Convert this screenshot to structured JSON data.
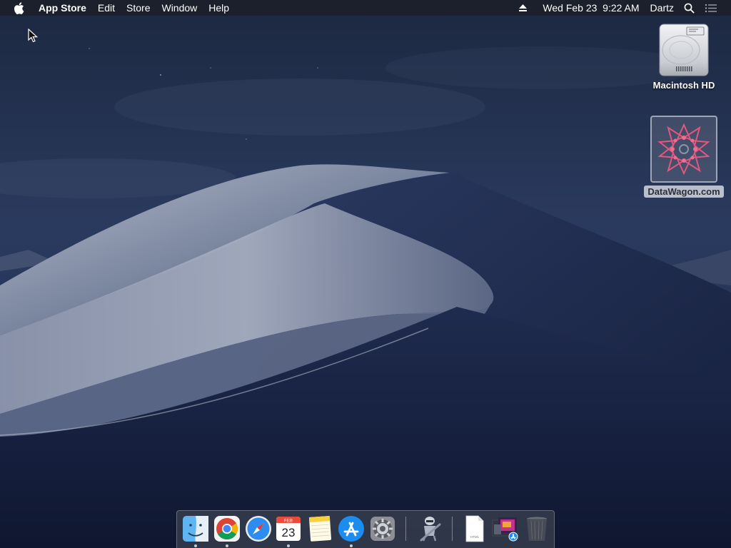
{
  "menubar": {
    "app_name": "App Store",
    "menus": [
      "Edit",
      "Store",
      "Window",
      "Help"
    ],
    "datetime": "Wed Feb 23  9:22 AM",
    "user": "Dartz"
  },
  "desktop_icons": {
    "hd": {
      "label": "Macintosh HD"
    },
    "datawagon": {
      "label": "DataWagon.com"
    }
  },
  "dock": {
    "items": [
      {
        "name": "finder",
        "running": true
      },
      {
        "name": "chrome",
        "running": true
      },
      {
        "name": "safari",
        "running": false
      },
      {
        "name": "calendar",
        "running": true,
        "month": "FEB",
        "day": "23"
      },
      {
        "name": "notes",
        "running": false
      },
      {
        "name": "app-store",
        "running": true
      },
      {
        "name": "system-preferences",
        "running": false
      },
      {
        "name": "automator",
        "running": false
      },
      {
        "name": "html-document",
        "running": false,
        "label": "HTML"
      },
      {
        "name": "downloads-stack",
        "running": false
      },
      {
        "name": "trash",
        "running": false
      }
    ]
  },
  "colors": {
    "menubar": "#1c202a",
    "sky_top": "#1f2c45",
    "dune_light": "#9aa3b8",
    "dune_shadow": "#1c2748",
    "accent_blue": "#1b8cf0"
  }
}
